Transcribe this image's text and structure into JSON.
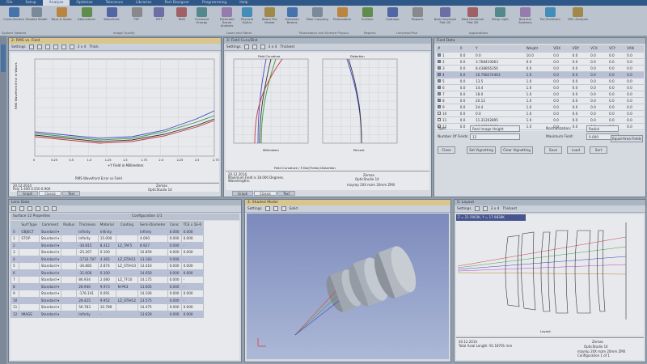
{
  "menu": [
    "File",
    "Setup",
    "Analyze",
    "Optimize",
    "Tolerance",
    "Libraries",
    "Part Designer",
    "Programming",
    "Help"
  ],
  "ribbon": {
    "buttons": [
      "Cross-Section",
      "Shaded Model",
      "Rays & Spots",
      "Aberrations",
      "Wavefront",
      "PSF",
      "MTF",
      "RMS",
      "Enclosed Energy",
      "Extended Scene Analysis",
      "Physical Optics",
      "Beam File Viewer",
      "Gaussian Beams",
      "Fiber Coupling",
      "Polarization",
      "Surface",
      "Coatings",
      "Reports",
      "New Universal Plot 1D",
      "New Universal Plot 2D",
      "Stray Light",
      "Biocular Systems",
      "Pol./Freeform",
      "RSC Analysis"
    ],
    "groups": [
      "System Viewers",
      "Image Quality",
      "Laser and Fibers",
      "Polarization and Surface Physics",
      "Reports",
      "Universal Plot",
      "Applications"
    ]
  },
  "win_rms": {
    "title": "2: RMS vs. Field",
    "toolbar": "Settings",
    "layout": "3 x 4",
    "thick": "Thick",
    "ylabel": "RMS Wavefront Error in Waves",
    "xlabel": "+Y Field in Millimeters",
    "caption": "RMS Wavefront Error vs Field",
    "info_date": "20.12.2014",
    "info_poly": "Poly  1.400  0.550  0.900",
    "info_ref": "Reference: Centroid",
    "info_company": "Zemax",
    "info_product": "OpticStudio 14",
    "info_file": "mzymp 20X mzm 20mm ZMX",
    "xticks": [
      "0",
      "0.25",
      "0.5",
      "1.0",
      "1.25",
      "1.5",
      "1.75",
      "2.0",
      "2.25",
      "2.5",
      "2.75"
    ],
    "tabs": [
      "Graph",
      "Classic",
      "Text"
    ]
  },
  "win_fc": {
    "title": "3: Field Curv/Dist",
    "toolbar": "Settings",
    "layout": "3 x 4",
    "thick": "Thickest",
    "left_title": "Field Curvature",
    "right_title": "Distortion",
    "left_x": "Millimeters",
    "right_x": "Percent",
    "caption": "Field Curvature / F-Tan(Theta) Distortion",
    "info_date": "20.12.2014",
    "info_line1": "Maximum Field is 18.000 Degrees.",
    "info_line2": "Wavelengths:",
    "info_company": "Zemax",
    "info_product": "OpticStudio 14",
    "info_file": "mzymp 20X mzm 20mm ZMX",
    "tabs": [
      "Graph",
      "Classic",
      "Text"
    ]
  },
  "field_data": {
    "title": "Field Data",
    "headers": [
      "#",
      "X",
      "Y",
      "Weight",
      "VDX",
      "VDY",
      "VCX",
      "VCY",
      "VAN"
    ],
    "rows": [
      [
        "1",
        "0.0",
        "0.0",
        "10.0",
        "0.0",
        "0.0",
        "0.0",
        "0.0",
        "0.0"
      ],
      [
        "2",
        "0.0",
        "3.768410063",
        "0.0",
        "0.0",
        "0.0",
        "0.0",
        "0.0",
        "0.0"
      ],
      [
        "3",
        "0.0",
        "8.438856356",
        "0.0",
        "0.0",
        "0.0",
        "0.0",
        "0.0",
        "0.0"
      ],
      [
        "4",
        "0.0",
        "10.768274463",
        "1.0",
        "0.0",
        "0.0",
        "0.0",
        "0.0",
        "0.0"
      ],
      [
        "5",
        "0.0",
        "13.5",
        "1.0",
        "0.0",
        "0.0",
        "0.0",
        "0.0",
        "0.0"
      ],
      [
        "6",
        "0.0",
        "14.4",
        "1.0",
        "0.0",
        "0.0",
        "0.0",
        "0.0",
        "0.0"
      ],
      [
        "7",
        "0.0",
        "18.0",
        "1.0",
        "0.0",
        "0.0",
        "0.0",
        "0.0",
        "0.0"
      ],
      [
        "8",
        "0.0",
        "20.12",
        "1.0",
        "0.0",
        "0.0",
        "0.0",
        "0.0",
        "0.0"
      ],
      [
        "9",
        "0.0",
        "24.4",
        "1.0",
        "0.0",
        "0.0",
        "0.0",
        "0.0",
        "0.0"
      ],
      [
        "10",
        "0.0",
        "0.0",
        "1.0",
        "0.0",
        "0.0",
        "0.0",
        "0.0",
        "0.0"
      ],
      [
        "11",
        "0.0",
        "11.31202895",
        "1.0",
        "0.0",
        "0.0",
        "0.0",
        "0.0",
        "0.0"
      ],
      [
        "12",
        "0.0",
        "16.97890963",
        "1.0",
        "0.0",
        "0.0",
        "0.0",
        "0.0",
        "0.0"
      ]
    ],
    "type_label": "Type:",
    "type_value": "Real Image Height",
    "num_label": "Number Of Fields:",
    "num_value": "12",
    "norm_label": "Normalization:",
    "norm_value": "Radial",
    "maxf_label": "Maximum Field:",
    "maxf_value": "9.000",
    "equal_btn": "Equal-Area Fields",
    "buttons": [
      "Close",
      "Set Vignetting",
      "Clear Vignetting",
      "Save",
      "Load",
      "Sort"
    ]
  },
  "lens_data": {
    "title": "Lens Data",
    "props": "Surface 12 Properties",
    "config": "Configuration 1/1",
    "headers": [
      "",
      "Surf:Type",
      "Comment",
      "Radius",
      "Thickness",
      "Material",
      "Coating",
      "Semi-Diameter",
      "Conic",
      "TCE x 1E-6"
    ],
    "rows": [
      [
        "0",
        "OBJECT",
        "Standard",
        "",
        "Infinity",
        "Infinity",
        "",
        "",
        "Infinity",
        "0.000",
        "0.000"
      ],
      [
        "1",
        "STOP",
        "Standard",
        "",
        "Infinity",
        "15.000",
        "",
        "",
        "4.000",
        "0.000",
        "0.000"
      ],
      [
        "2",
        "",
        "Standard",
        "",
        "-30.815",
        "8.312",
        "LZ_TAF5",
        "0",
        "8.927",
        "0.000",
        "-"
      ],
      [
        "3",
        "",
        "Standard",
        "",
        "-25.267",
        "0.100",
        "",
        "0",
        "10.859",
        "0.000",
        "0.000"
      ],
      [
        "4",
        "",
        "Standard",
        "",
        "-1732.787",
        "4.365",
        "LZ_STIH11",
        "0",
        "13.183",
        "0.000",
        "-"
      ],
      [
        "5",
        "",
        "Standard",
        "",
        "-36.885",
        "2.874",
        "LZ_STIH10",
        "0",
        "13.416",
        "0.000",
        "0.000"
      ],
      [
        "6",
        "",
        "Standard",
        "",
        "-31.600",
        "0.100",
        "",
        "0",
        "14.050",
        "0.000",
        "0.000"
      ],
      [
        "7",
        "",
        "Standard",
        "",
        "86.934",
        "2.080",
        "LZ_TF10",
        "0",
        "14.175",
        "0.000",
        "-"
      ],
      [
        "8",
        "",
        "Standard",
        "",
        "28.940",
        "9.973",
        "N-PK3",
        "0",
        "13.605",
        "0.000",
        "-"
      ],
      [
        "9",
        "",
        "Standard",
        "",
        "-176.141",
        "0.091",
        "",
        "0",
        "14.106",
        "0.000",
        "0.000"
      ],
      [
        "10",
        "",
        "Standard",
        "",
        "28.425",
        "9.952",
        "LZ_STIH12",
        "0",
        "13.575",
        "0.000",
        "-"
      ],
      [
        "11",
        "",
        "Standard",
        "",
        "56.783",
        "10.789",
        "",
        "0",
        "14.475",
        "0.000",
        "0.000"
      ],
      [
        "12",
        "IMAGE",
        "Standard",
        "",
        "Infinity",
        "-",
        "",
        "",
        "13.629",
        "0.000",
        "0.000"
      ]
    ]
  },
  "shaded": {
    "title": "4: Shaded Model",
    "toolbar": "Settings",
    "mode": "Solid"
  },
  "layout": {
    "title": "5: Layout",
    "toolbar": "Settings",
    "layout": "3 x 4",
    "thick": "Thickest",
    "readout": "Z = 21.5903K, Y = 17.9838K",
    "caption": "Layout",
    "info_date": "20.12.2014",
    "info_line": "Total Axial Length: 91.18791 mm",
    "info_company": "Zemax",
    "info_product": "OpticStudio 14",
    "info_file": "mzymp 20X mzm 20mm ZMX",
    "info_config": "Configuration 1 of 1"
  }
}
